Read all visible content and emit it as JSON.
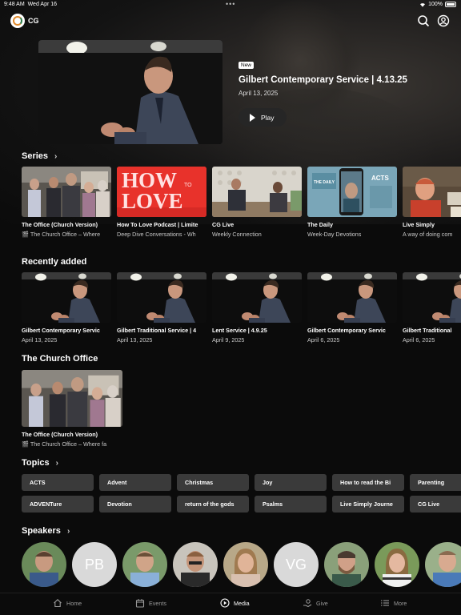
{
  "status": {
    "time": "9:48 AM",
    "date": "Wed Apr 16",
    "battery": "100%"
  },
  "app": {
    "brand": "CG"
  },
  "featured": {
    "badge": "New",
    "title": "Gilbert Contemporary Service | 4.13.25",
    "date": "April 13, 2025",
    "play_label": "Play"
  },
  "series": {
    "title": "Series",
    "items": [
      {
        "title": "The Office (Church Version)",
        "subtitle": "🎬 The Church Office – Where"
      },
      {
        "title": "How To Love Podcast | Limite",
        "subtitle": "Deep Dive Conversations - Wh",
        "art_line1": "HOW",
        "art_to": "TO",
        "art_line2": "LOVE"
      },
      {
        "title": "CG Live",
        "subtitle": "Weekly Connection"
      },
      {
        "title": "The Daily",
        "subtitle": "Week-Day Devotions",
        "art_left": "THE DAILY",
        "art_right": "ACTS"
      },
      {
        "title": "Live Simply",
        "subtitle": "A way of doing com"
      }
    ]
  },
  "recent": {
    "title": "Recently added",
    "items": [
      {
        "title": "Gilbert Contemporary Servic",
        "date": "April 13, 2025"
      },
      {
        "title": "Gilbert Traditional Service | 4",
        "date": "April 13, 2025"
      },
      {
        "title": "Lent Service | 4.9.25",
        "date": "April 9, 2025"
      },
      {
        "title": "Gilbert Contemporary Servic",
        "date": "April 6, 2025"
      },
      {
        "title": "Gilbert Traditional",
        "date": "April 6, 2025"
      }
    ]
  },
  "office": {
    "title": "The Church Office",
    "item": {
      "title": "The Office (Church Version)",
      "subtitle": "🎬 The Church Office – Where fa"
    }
  },
  "topics": {
    "title": "Topics",
    "items": [
      "ACTS",
      "Advent",
      "Christmas",
      "Joy",
      "How to read the Bi",
      "Parenting",
      "ADVENTure",
      "Devotion",
      "return of the gods",
      "Psalms",
      "Live Simply Journe",
      "CG Live"
    ]
  },
  "speakers": {
    "title": "Speakers",
    "initials": [
      "PB",
      "VG"
    ]
  },
  "tabs": [
    {
      "label": "Home",
      "icon": "home-icon"
    },
    {
      "label": "Events",
      "icon": "calendar-icon"
    },
    {
      "label": "Media",
      "icon": "play-circle-icon",
      "active": true
    },
    {
      "label": "Give",
      "icon": "give-icon"
    },
    {
      "label": "More",
      "icon": "list-icon"
    }
  ],
  "colors": {
    "accent_orange": "#e08a2c",
    "accent_green": "#2f7d4a",
    "love_red": "#e8322b"
  }
}
